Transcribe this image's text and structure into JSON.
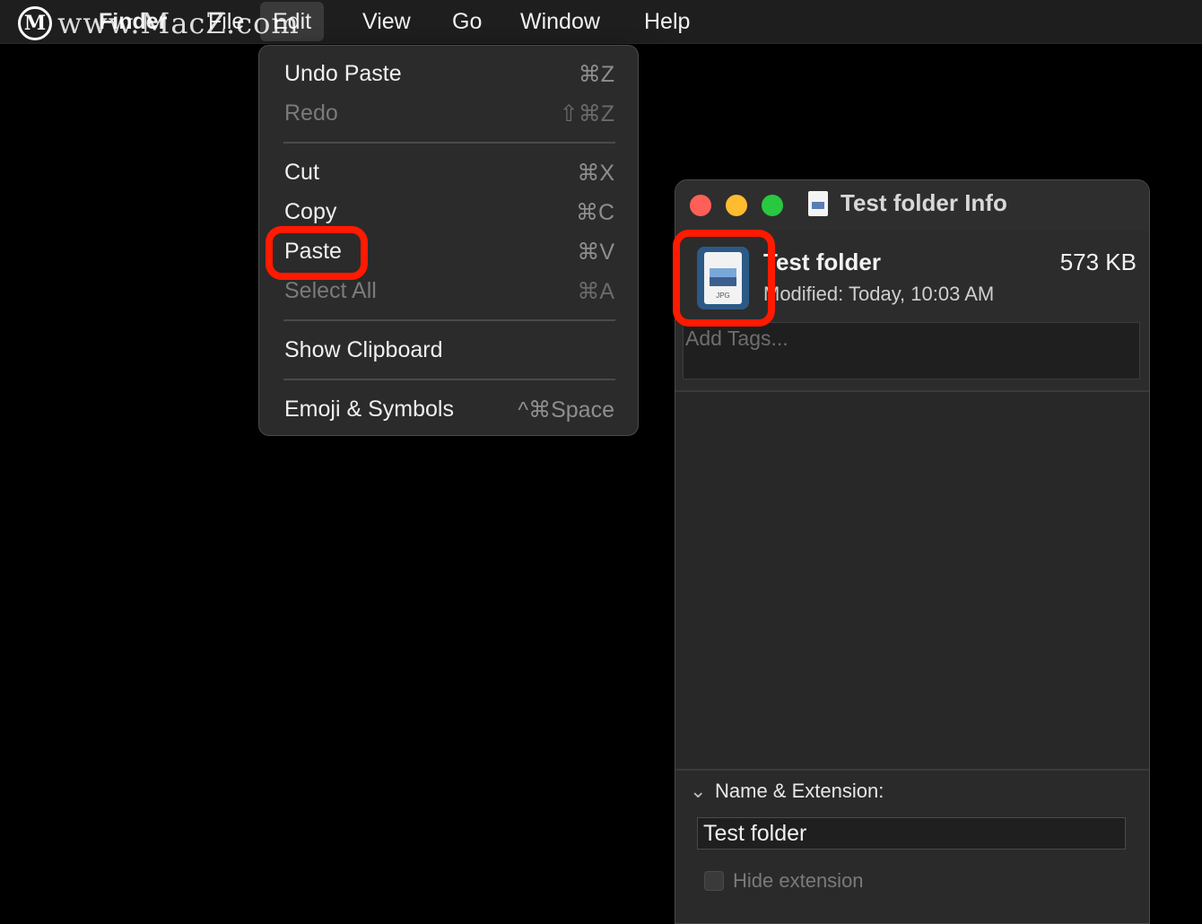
{
  "watermark": {
    "logo_letter": "M",
    "text": "www.MacZ.com"
  },
  "menubar": {
    "finder": "Finder",
    "file": "File",
    "edit": "Edit",
    "view": "View",
    "go": "Go",
    "window": "Window",
    "help": "Help"
  },
  "edit_menu": {
    "items": [
      {
        "label": "Undo Paste",
        "shortcut": "⌘Z"
      },
      {
        "label": "Redo",
        "shortcut": "⇧⌘Z"
      },
      {
        "label": "Cut",
        "shortcut": "⌘X"
      },
      {
        "label": "Copy",
        "shortcut": "⌘C"
      },
      {
        "label": "Paste",
        "shortcut": "⌘V"
      },
      {
        "label": "Select All",
        "shortcut": "⌘A"
      },
      {
        "label": "Show Clipboard",
        "shortcut": ""
      },
      {
        "label": "Emoji & Symbols",
        "shortcut": "^⌘Space"
      }
    ]
  },
  "info_window": {
    "title": "Test folder Info",
    "file_name": "Test folder",
    "file_size": "573 KB",
    "modified": "Modified:  Today, 10:03 AM",
    "file_ext_badge": "JPG",
    "tags_placeholder": "Add Tags...",
    "name_section": {
      "heading": "Name & Extension:",
      "value": "Test folder",
      "hide_extension": "Hide extension"
    }
  },
  "colors": {
    "highlight": "#ff1a00",
    "close": "#ff5f57",
    "minimize": "#febc2e",
    "zoom": "#28c840"
  }
}
